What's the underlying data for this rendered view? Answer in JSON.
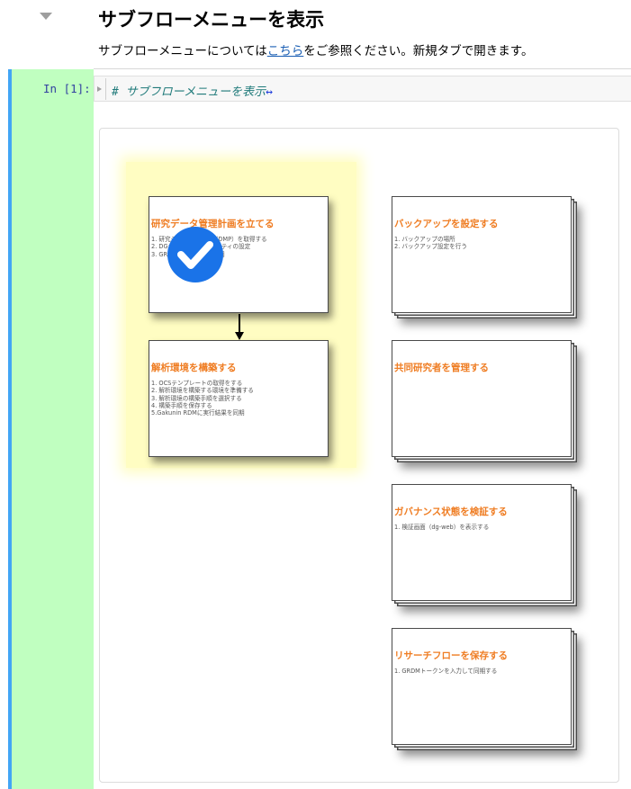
{
  "markdown": {
    "title": "サブフローメニューを表示",
    "para_before": "サブフローメニューについては",
    "para_link": "こちら",
    "para_after": "をご参照ください。新規タブで開きます。"
  },
  "cell": {
    "prompt": "In [1]:",
    "code": "# サブフローメニューを表示",
    "arrow": "↔"
  },
  "diagram": {
    "cards": [
      {
        "title": "研究データ管理計画を立てる",
        "items": [
          "1. 研究データ管理計画（DMP）を取得する",
          "2. DGカスタマイズプロパティの設定",
          "3. GRDMに実行結果を同期"
        ]
      },
      {
        "title": "解析環境を構築する",
        "items": [
          "1. OCSテンプレートの取得をする",
          "2. 解析環境を構築する環境を準備する",
          "3. 解析環境の構築手順を選択する",
          "4. 構築手順を保存する",
          "5.Gakunin RDMに実行結果を同期"
        ]
      },
      {
        "title": "バックアップを設定する",
        "items": [
          "1. バックアップの場所",
          "2. バックアップ設定を行う"
        ]
      },
      {
        "title": "共同研究者を管理する",
        "items": []
      },
      {
        "title": "ガバナンス状態を検証する",
        "items": [
          "1. 検証画面（dg-web）を表示する"
        ]
      },
      {
        "title": "リサーチフローを保存する",
        "items": [
          "1. GRDMトークンを入力して同期する"
        ]
      }
    ],
    "colors": {
      "highlight": "#fffdc2",
      "title": "#ef7d23",
      "check": "#1a73e8"
    }
  }
}
